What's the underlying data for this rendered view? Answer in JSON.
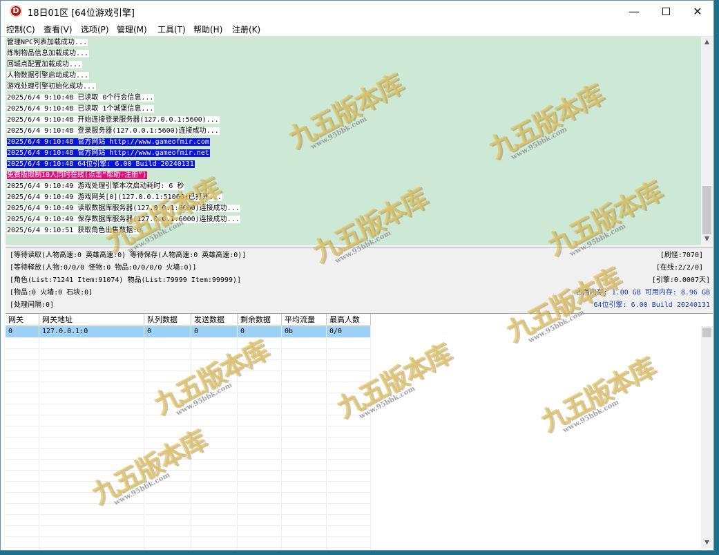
{
  "window": {
    "title": "18日01区 [64位游戏引擎]",
    "icon_letter": "D",
    "controls": {
      "minimize": "—",
      "close": "✕"
    }
  },
  "menu": [
    {
      "label": "控制(C)"
    },
    {
      "label": "查看(V)"
    },
    {
      "label": "选项(P)"
    },
    {
      "label": "管理(M)"
    },
    {
      "label": "工具(T)"
    },
    {
      "label": "帮助(H)"
    },
    {
      "label": "注册(K)"
    }
  ],
  "log": [
    {
      "text": "管理NPC列表加载成功...",
      "style": "white"
    },
    {
      "text": "炼制物品信息加载成功...",
      "style": "white"
    },
    {
      "text": "回城点配置加载成功...",
      "style": "white"
    },
    {
      "text": "人物数据引擎启动成功...",
      "style": "white"
    },
    {
      "text": "游戏处理引擎初始化成功...",
      "style": "white"
    },
    {
      "text": "2025/6/4 9:10:48 已读取 0个行会信息...",
      "style": "white"
    },
    {
      "text": "2025/6/4 9:10:48 已读取 1个城堡信息...",
      "style": "white"
    },
    {
      "text": "2025/6/4 9:10:48 开始连接登录服务器(127.0.0.1:5600)...",
      "style": "white"
    },
    {
      "text": "2025/6/4 9:10:48 登录服务器(127.0.0.1:5600)连接成功...",
      "style": "white"
    },
    {
      "text": "2025/6/4 9:10:48 官方网站 http://www.gameofmir.com",
      "style": "blue"
    },
    {
      "text": "2025/6/4 9:10:48 官方网站 http://www.gameofmir.net",
      "style": "blue"
    },
    {
      "text": "2025/6/4 9:10:48 64位引擎: 6.00 Build 20240131",
      "style": "blue"
    },
    {
      "text": "免费版限制10人同时在线(点击“帮助-注册”)",
      "style": "pink"
    },
    {
      "text": "2025/6/4 9:10:49 游戏处理引擎本次启动耗时: 6 秒",
      "style": "white"
    },
    {
      "text": "2025/6/4 9:10:49 游戏网关[0](127.0.0.1:51060)已打开...",
      "style": "white"
    },
    {
      "text": "2025/6/4 9:10:49 读取数据库服务器(127.0.0.1:6000)连接成功...",
      "style": "white"
    },
    {
      "text": "2025/6/4 9:10:49 保存数据库服务器(127.0.0.1:6000)连接成功...",
      "style": "white"
    },
    {
      "text": "2025/6/4 9:10:51 获取角色出售数据:0",
      "style": "white"
    }
  ],
  "status": {
    "line1": "[等待读取(人物高速:0 英雄高速:0) 等待保存(人物高速:0 英雄高速:0)]",
    "line2": "[等待释放(人物:0/0/0 怪物:0 物品:0/0/0/0 火墙:0)]",
    "line3": "[角色(List:71241 Item:91074) 物品(List:79999 Item:99999)]",
    "line4": "[物品:0 火墙:0 石块:0]",
    "line5": "[处理间隔:0]",
    "refresh": "[刷怪:7070]",
    "online": "[在线:2/2/0]",
    "engine_time": "[引擎:0.0007天]",
    "memory": "占用内存: 1.00 GB 可用内存: 8.96 GB",
    "build": "64位引擎: 6.00 Build 20240131"
  },
  "gateway_table": {
    "columns": [
      "网关",
      "网关地址",
      "队列数据",
      "发送数据",
      "剩余数据",
      "平均流量",
      "最高人数"
    ],
    "rows": [
      [
        "0",
        "127.0.0.1:0",
        "0",
        "0",
        "0",
        "0b",
        "0/0"
      ]
    ]
  },
  "watermark": {
    "main": "九五版本库",
    "url": "www.95bbk.com"
  },
  "colors": {
    "log_bg": "#cde8d5",
    "highlight_blue": "#0a14d6",
    "highlight_pink": "#e0107a",
    "selected_row": "#9fd0f5",
    "status_blue": "#1b3fb8"
  }
}
